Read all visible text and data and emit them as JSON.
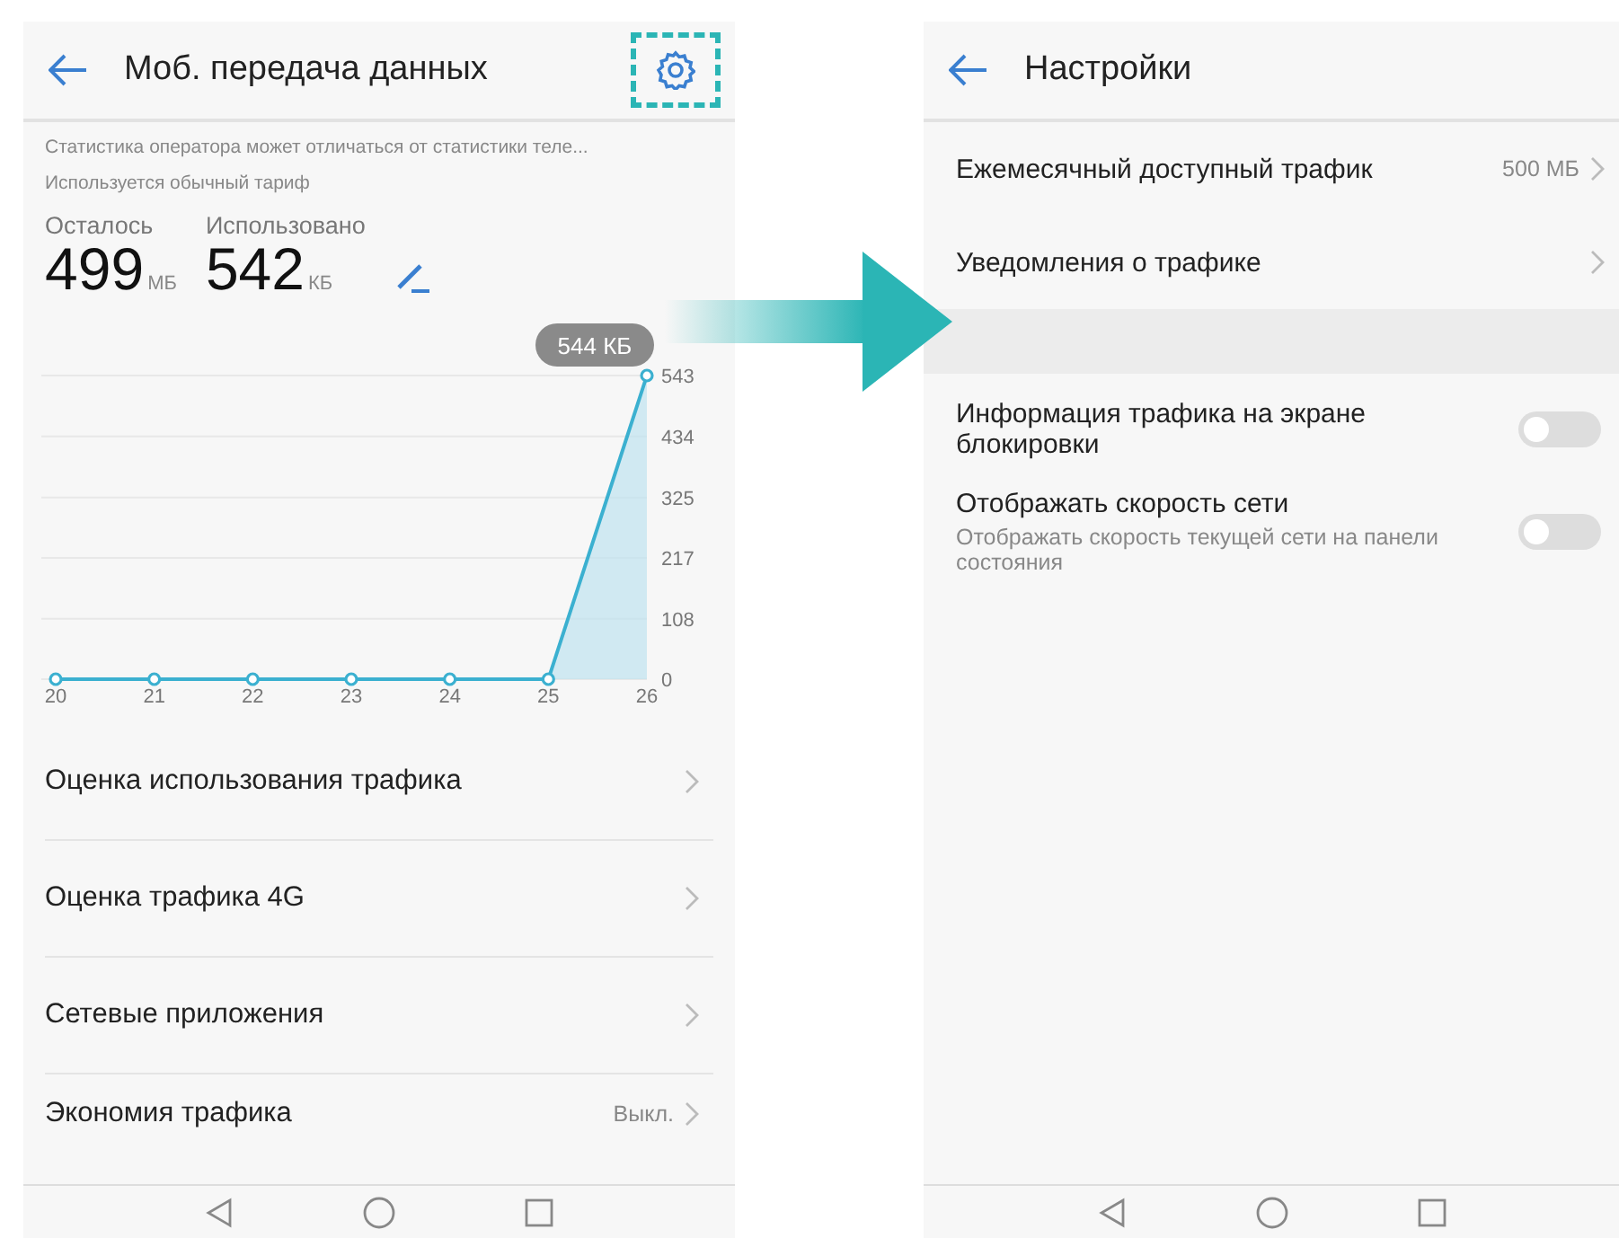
{
  "left_screen": {
    "title": "Моб. передача данных",
    "notes": [
      "Статистика оператора может отличаться от статистики теле...",
      "Используется обычный тариф"
    ],
    "stats": [
      {
        "label": "Осталось",
        "value": "499",
        "unit": "МБ"
      },
      {
        "label": "Использовано",
        "value": "542",
        "unit": "КБ"
      }
    ],
    "chart_tooltip": "544 КБ",
    "chart_data": {
      "type": "area",
      "categories": [
        "20",
        "21",
        "22",
        "23",
        "24",
        "25",
        "26"
      ],
      "series": [
        {
          "color": "#3bb0d0",
          "values": [
            0,
            0,
            0,
            0,
            0,
            0,
            543
          ]
        }
      ],
      "grid": true,
      "ylim": [
        0,
        543
      ],
      "yticks": [
        0,
        108,
        217,
        325,
        434,
        543
      ]
    },
    "items": [
      {
        "label": "Оценка использования трафика"
      },
      {
        "label": "Оценка трафика 4G"
      },
      {
        "label": "Сетевые приложения"
      },
      {
        "label": "Экономия трафика",
        "value": "Выкл."
      }
    ]
  },
  "right_screen": {
    "title": "Настройки",
    "items": [
      {
        "kind": "link",
        "label": "Ежемесячный доступный трафик",
        "value": "500 МБ"
      },
      {
        "kind": "link",
        "label": "Уведомления о трафике"
      },
      {
        "kind": "spacer"
      },
      {
        "kind": "toggle",
        "label": "Информация трафика на экране блокировки",
        "on": false
      },
      {
        "kind": "toggle",
        "label": "Отображать скорость сети",
        "description": "Отображать скорость текущей сети на панели состояния",
        "on": false
      }
    ]
  }
}
